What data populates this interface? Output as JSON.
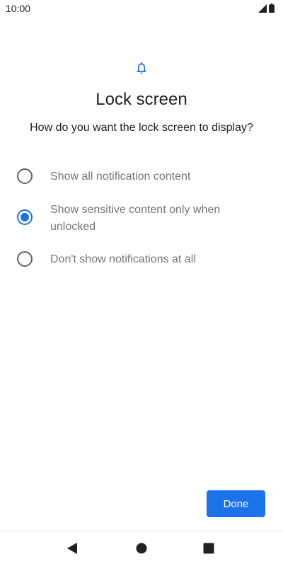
{
  "status_bar": {
    "time": "10:00",
    "icons": [
      "signal-icon",
      "battery-icon"
    ]
  },
  "header": {
    "icon": "bell-icon",
    "title": "Lock screen",
    "subtitle": "How do you want the lock screen to display?"
  },
  "options": [
    {
      "label": "Show all notification content",
      "selected": false
    },
    {
      "label": "Show sensitive content only when unlocked",
      "selected": true
    },
    {
      "label": "Don't show notifications at all",
      "selected": false
    }
  ],
  "footer": {
    "done_label": "Done"
  },
  "nav_bar": {
    "buttons": [
      "back-icon",
      "home-icon",
      "recents-icon"
    ]
  },
  "colors": {
    "accent": "#1a73e8",
    "text_primary": "#202124",
    "text_secondary": "#757575"
  }
}
